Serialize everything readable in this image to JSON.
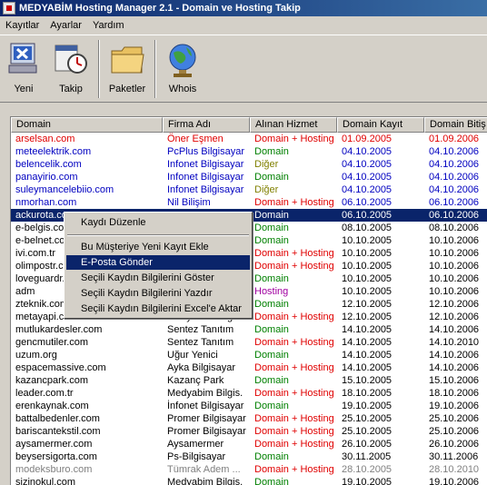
{
  "window": {
    "title": "MEDYABİM Hosting Manager 2.1 - Domain ve Hosting Takip"
  },
  "menu": [
    "Kayıtlar",
    "Ayarlar",
    "Yardım"
  ],
  "toolbar": {
    "yeni": "Yeni",
    "takip": "Takip",
    "paketler": "Paketler",
    "whois": "Whois"
  },
  "colors": {
    "red": "#e00000",
    "blue": "#0000c0",
    "green": "#008000",
    "olive": "#808000",
    "purple": "#a000a0",
    "gray": "#808080",
    "black": "#000000"
  },
  "table": {
    "headers": [
      "Domain",
      "Firma Adı",
      "Alınan Hizmet",
      "Domain Kayıt",
      "Domain Bitiş"
    ],
    "rows": [
      {
        "domain": "arselsan.com",
        "firma": "Öner Eşmen",
        "hizmet": "Domain + Hosting",
        "kayit": "01.09.2005",
        "bitis": "01.09.2006",
        "c": "red",
        "hc": "red"
      },
      {
        "domain": "meteelektrik.com",
        "firma": "PcPlus Bilgisayar",
        "hizmet": "Domain",
        "kayit": "04.10.2005",
        "bitis": "04.10.2006",
        "c": "blue",
        "hc": "green"
      },
      {
        "domain": "belencelik.com",
        "firma": "Infonet Bilgisayar",
        "hizmet": "Diğer",
        "kayit": "04.10.2005",
        "bitis": "04.10.2006",
        "c": "blue",
        "hc": "olive"
      },
      {
        "domain": "panayirio.com",
        "firma": "Infonet Bilgisayar",
        "hizmet": "Domain",
        "kayit": "04.10.2005",
        "bitis": "04.10.2006",
        "c": "blue",
        "hc": "green"
      },
      {
        "domain": "suleymancelebiio.com",
        "firma": "Infonet Bilgisayar",
        "hizmet": "Diğer",
        "kayit": "04.10.2005",
        "bitis": "04.10.2006",
        "c": "blue",
        "hc": "olive"
      },
      {
        "domain": "nmorhan.com",
        "firma": "Nil Bilişim",
        "hizmet": "Domain + Hosting",
        "kayit": "06.10.2005",
        "bitis": "06.10.2006",
        "c": "blue",
        "hc": "red"
      },
      {
        "domain": "ackurota.com",
        "firma": "",
        "hizmet": "Domain",
        "kayit": "06.10.2005",
        "bitis": "06.10.2006",
        "c": "black",
        "hc": "green",
        "sel": true
      },
      {
        "domain": "e-belgis.com",
        "firma": "",
        "hizmet": "Domain",
        "kayit": "08.10.2005",
        "bitis": "08.10.2006",
        "c": "black",
        "hc": "green"
      },
      {
        "domain": "e-belnet.com",
        "firma": "",
        "hizmet": "Domain",
        "kayit": "10.10.2005",
        "bitis": "10.10.2006",
        "c": "black",
        "hc": "green"
      },
      {
        "domain": "ivi.com.tr",
        "firma": "",
        "hizmet": "Domain + Hosting",
        "kayit": "10.10.2005",
        "bitis": "10.10.2006",
        "c": "black",
        "hc": "red"
      },
      {
        "domain": "olimpostr.com",
        "firma": "",
        "hizmet": "Domain + Hosting",
        "kayit": "10.10.2005",
        "bitis": "10.10.2006",
        "c": "black",
        "hc": "red"
      },
      {
        "domain": "loveguardr.com",
        "firma": "",
        "hizmet": "Domain",
        "kayit": "10.10.2005",
        "bitis": "10.10.2006",
        "c": "black",
        "hc": "green"
      },
      {
        "domain": "adm",
        "firma": "",
        "hizmet": "Hosting",
        "kayit": "10.10.2005",
        "bitis": "10.10.2006",
        "c": "black",
        "hc": "purple"
      },
      {
        "domain": "zteknik.com",
        "firma": "",
        "hizmet": "Domain",
        "kayit": "12.10.2005",
        "bitis": "12.10.2006",
        "c": "black",
        "hc": "green"
      },
      {
        "domain": "metayapi.com",
        "firma": "Medyabim Bilgis.",
        "hizmet": "Domain + Hosting",
        "kayit": "12.10.2005",
        "bitis": "12.10.2006",
        "c": "black",
        "hc": "red"
      },
      {
        "domain": "mutlukardesler.com",
        "firma": "Sentez Tanıtım",
        "hizmet": "Domain",
        "kayit": "14.10.2005",
        "bitis": "14.10.2006",
        "c": "black",
        "hc": "green"
      },
      {
        "domain": "gencmutiler.com",
        "firma": "Sentez Tanıtım",
        "hizmet": "Domain + Hosting",
        "kayit": "14.10.2005",
        "bitis": "14.10.2010",
        "c": "black",
        "hc": "red"
      },
      {
        "domain": "uzum.org",
        "firma": "Uğur Yenici",
        "hizmet": "Domain",
        "kayit": "14.10.2005",
        "bitis": "14.10.2006",
        "c": "black",
        "hc": "green"
      },
      {
        "domain": "espacemassive.com",
        "firma": "Ayka Bilgisayar",
        "hizmet": "Domain + Hosting",
        "kayit": "14.10.2005",
        "bitis": "14.10.2006",
        "c": "black",
        "hc": "red"
      },
      {
        "domain": "kazancpark.com",
        "firma": "Kazanç Park",
        "hizmet": "Domain",
        "kayit": "15.10.2005",
        "bitis": "15.10.2006",
        "c": "black",
        "hc": "green"
      },
      {
        "domain": "leader.com.tr",
        "firma": "Medyabim Bilgis.",
        "hizmet": "Domain + Hosting",
        "kayit": "18.10.2005",
        "bitis": "18.10.2006",
        "c": "black",
        "hc": "red"
      },
      {
        "domain": "erenkaynak.com",
        "firma": "İnfonet Bilgisayar",
        "hizmet": "Domain",
        "kayit": "19.10.2005",
        "bitis": "19.10.2006",
        "c": "black",
        "hc": "green"
      },
      {
        "domain": "battalbedenler.com",
        "firma": "Promer Bilgisayar",
        "hizmet": "Domain + Hosting",
        "kayit": "25.10.2005",
        "bitis": "25.10.2006",
        "c": "black",
        "hc": "red"
      },
      {
        "domain": "bariscantekstil.com",
        "firma": "Promer Bilgisayar",
        "hizmet": "Domain + Hosting",
        "kayit": "25.10.2005",
        "bitis": "25.10.2006",
        "c": "black",
        "hc": "red"
      },
      {
        "domain": "aysamermer.com",
        "firma": "Aysamermer",
        "hizmet": "Domain + Hosting",
        "kayit": "26.10.2005",
        "bitis": "26.10.2006",
        "c": "black",
        "hc": "red"
      },
      {
        "domain": "beysersigorta.com",
        "firma": "Ps-Bilgisayar",
        "hizmet": "Domain",
        "kayit": "30.11.2005",
        "bitis": "30.11.2006",
        "c": "black",
        "hc": "green"
      },
      {
        "domain": "modeksburo.com",
        "firma": "Tümrak Adem ...",
        "hizmet": "Domain + Hosting",
        "kayit": "28.10.2005",
        "bitis": "28.10.2010",
        "c": "gray",
        "hc": "red"
      },
      {
        "domain": "sizinokul.com",
        "firma": "Medyabim Bilgis.",
        "hizmet": "Domain",
        "kayit": "19.10.2005",
        "bitis": "19.10.2006",
        "c": "black",
        "hc": "green"
      }
    ]
  },
  "context_menu": {
    "items": [
      "Kaydı Düzenle",
      "Bu Müşteriye Yeni Kayıt  Ekle",
      "E-Posta Gönder",
      "Seçili Kaydın Bilgilerini Göster",
      "Seçili Kaydın Bilgilerini Yazdır",
      "Seçili Kaydın Bilgilerini Excel'e Aktar"
    ],
    "highlighted_index": 2
  }
}
